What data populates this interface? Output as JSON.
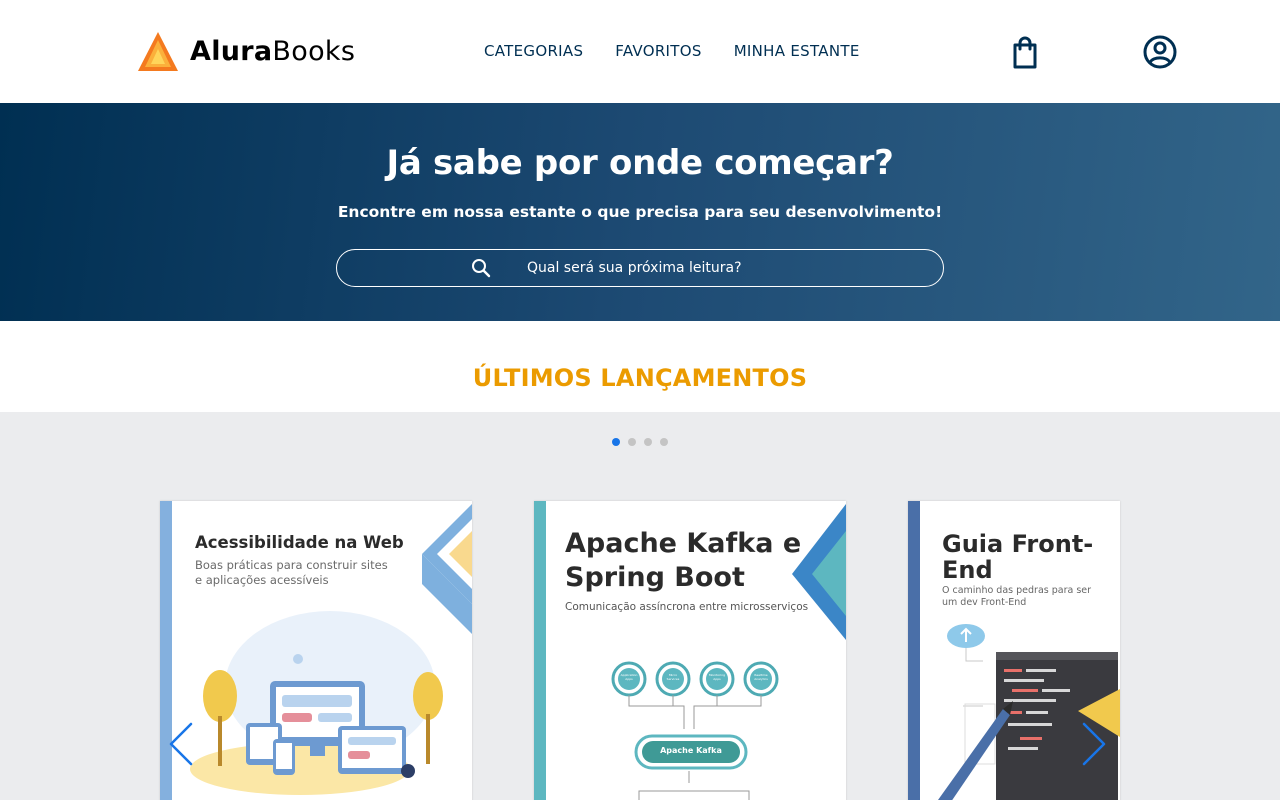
{
  "brand": {
    "name_bold": "Alura",
    "name_light": "Books",
    "accent": "#eb9b00",
    "primary": "#002f52"
  },
  "nav": {
    "items": [
      "CATEGORIAS",
      "FAVORITOS",
      "MINHA ESTANTE"
    ]
  },
  "header_icons": [
    "shopping-bag-icon",
    "user-account-icon"
  ],
  "hero": {
    "title": "Já sabe por onde começar?",
    "subtitle": "Encontre em nossa estante o que precisa para seu desenvolvimento!",
    "search_placeholder": "Qual será sua próxima leitura?"
  },
  "releases": {
    "title": "ÚLTIMOS LANÇAMENTOS",
    "active_dot": 1,
    "dot_count": 4,
    "books": [
      {
        "title": "Acessibilidade na Web",
        "subtitle": "Boas práticas para construir sites e aplicações acessíveis"
      },
      {
        "title": "Apache Kafka e Spring Boot",
        "subtitle": "Comunicação assíncrona entre microsserviços",
        "diagram": {
          "nodes": [
            "Application Apps",
            "Micro Services",
            "Monitoring Apps",
            "Realtime Analytics"
          ],
          "center": "Apache Kafka"
        }
      },
      {
        "title": "Guia Front-End",
        "subtitle": "O caminho das pedras para ser um dev Front-End"
      }
    ]
  }
}
